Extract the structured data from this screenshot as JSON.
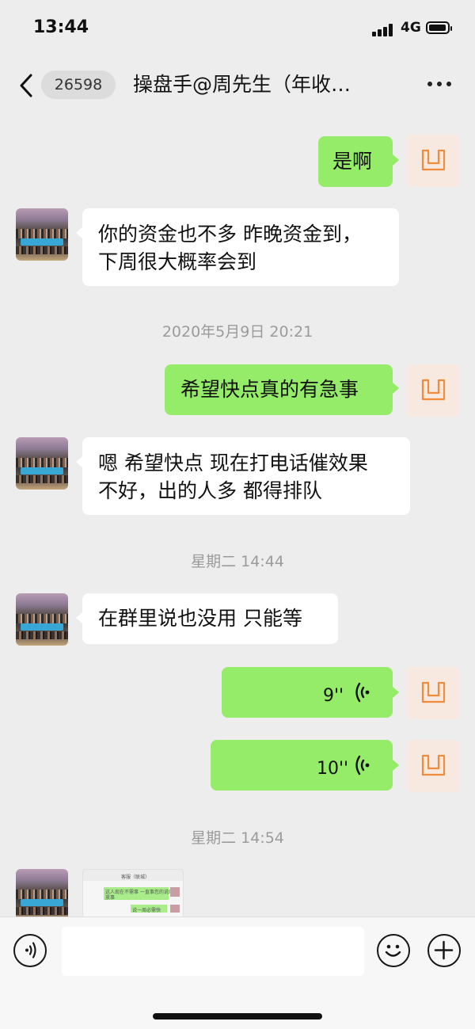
{
  "status_bar": {
    "time": "13:44",
    "network": "4G"
  },
  "nav": {
    "unread_badge": "26598",
    "title": "操盘手@周先生（年收…"
  },
  "messages": [
    {
      "side": "right",
      "type": "text",
      "text": "是啊"
    },
    {
      "side": "left",
      "type": "text",
      "lines": [
        "你的资金也不多 昨晚资金到，",
        "下周很大概率会到"
      ]
    },
    {
      "type": "timestamp",
      "text": "2020年5月9日 20:21"
    },
    {
      "side": "right",
      "type": "text",
      "text": "希望快点真的有急事"
    },
    {
      "side": "left",
      "type": "text",
      "lines": [
        "嗯 希望快点 现在打电话催效果",
        "不好，出的人多 都得排队"
      ]
    },
    {
      "type": "timestamp",
      "text": "星期二 14:44"
    },
    {
      "side": "left",
      "type": "text",
      "text": "在群里说也没用 只能等"
    },
    {
      "side": "right",
      "type": "voice",
      "duration": "9''"
    },
    {
      "side": "right",
      "type": "voice",
      "duration": "10''"
    },
    {
      "type": "timestamp",
      "text": "星期二 14:54"
    },
    {
      "side": "left",
      "type": "image"
    }
  ],
  "thumbnail_text": {
    "header": "客服（联城）",
    "line1": "这人现在不需事 一直事您的说同",
    "line1b": "放事",
    "line2": "说一周必需快"
  },
  "input_bar": {
    "placeholder": ""
  },
  "icons": {
    "back": "chevron-left-icon",
    "more": "more-dots-icon",
    "voice": "voice-input-icon",
    "emoji": "emoji-icon",
    "plus": "plus-icon"
  },
  "colors": {
    "chat_background": "#ededed",
    "my_bubble": "#95ec69",
    "their_bubble": "#ffffff",
    "timestamp_text": "#9b9b9b"
  }
}
